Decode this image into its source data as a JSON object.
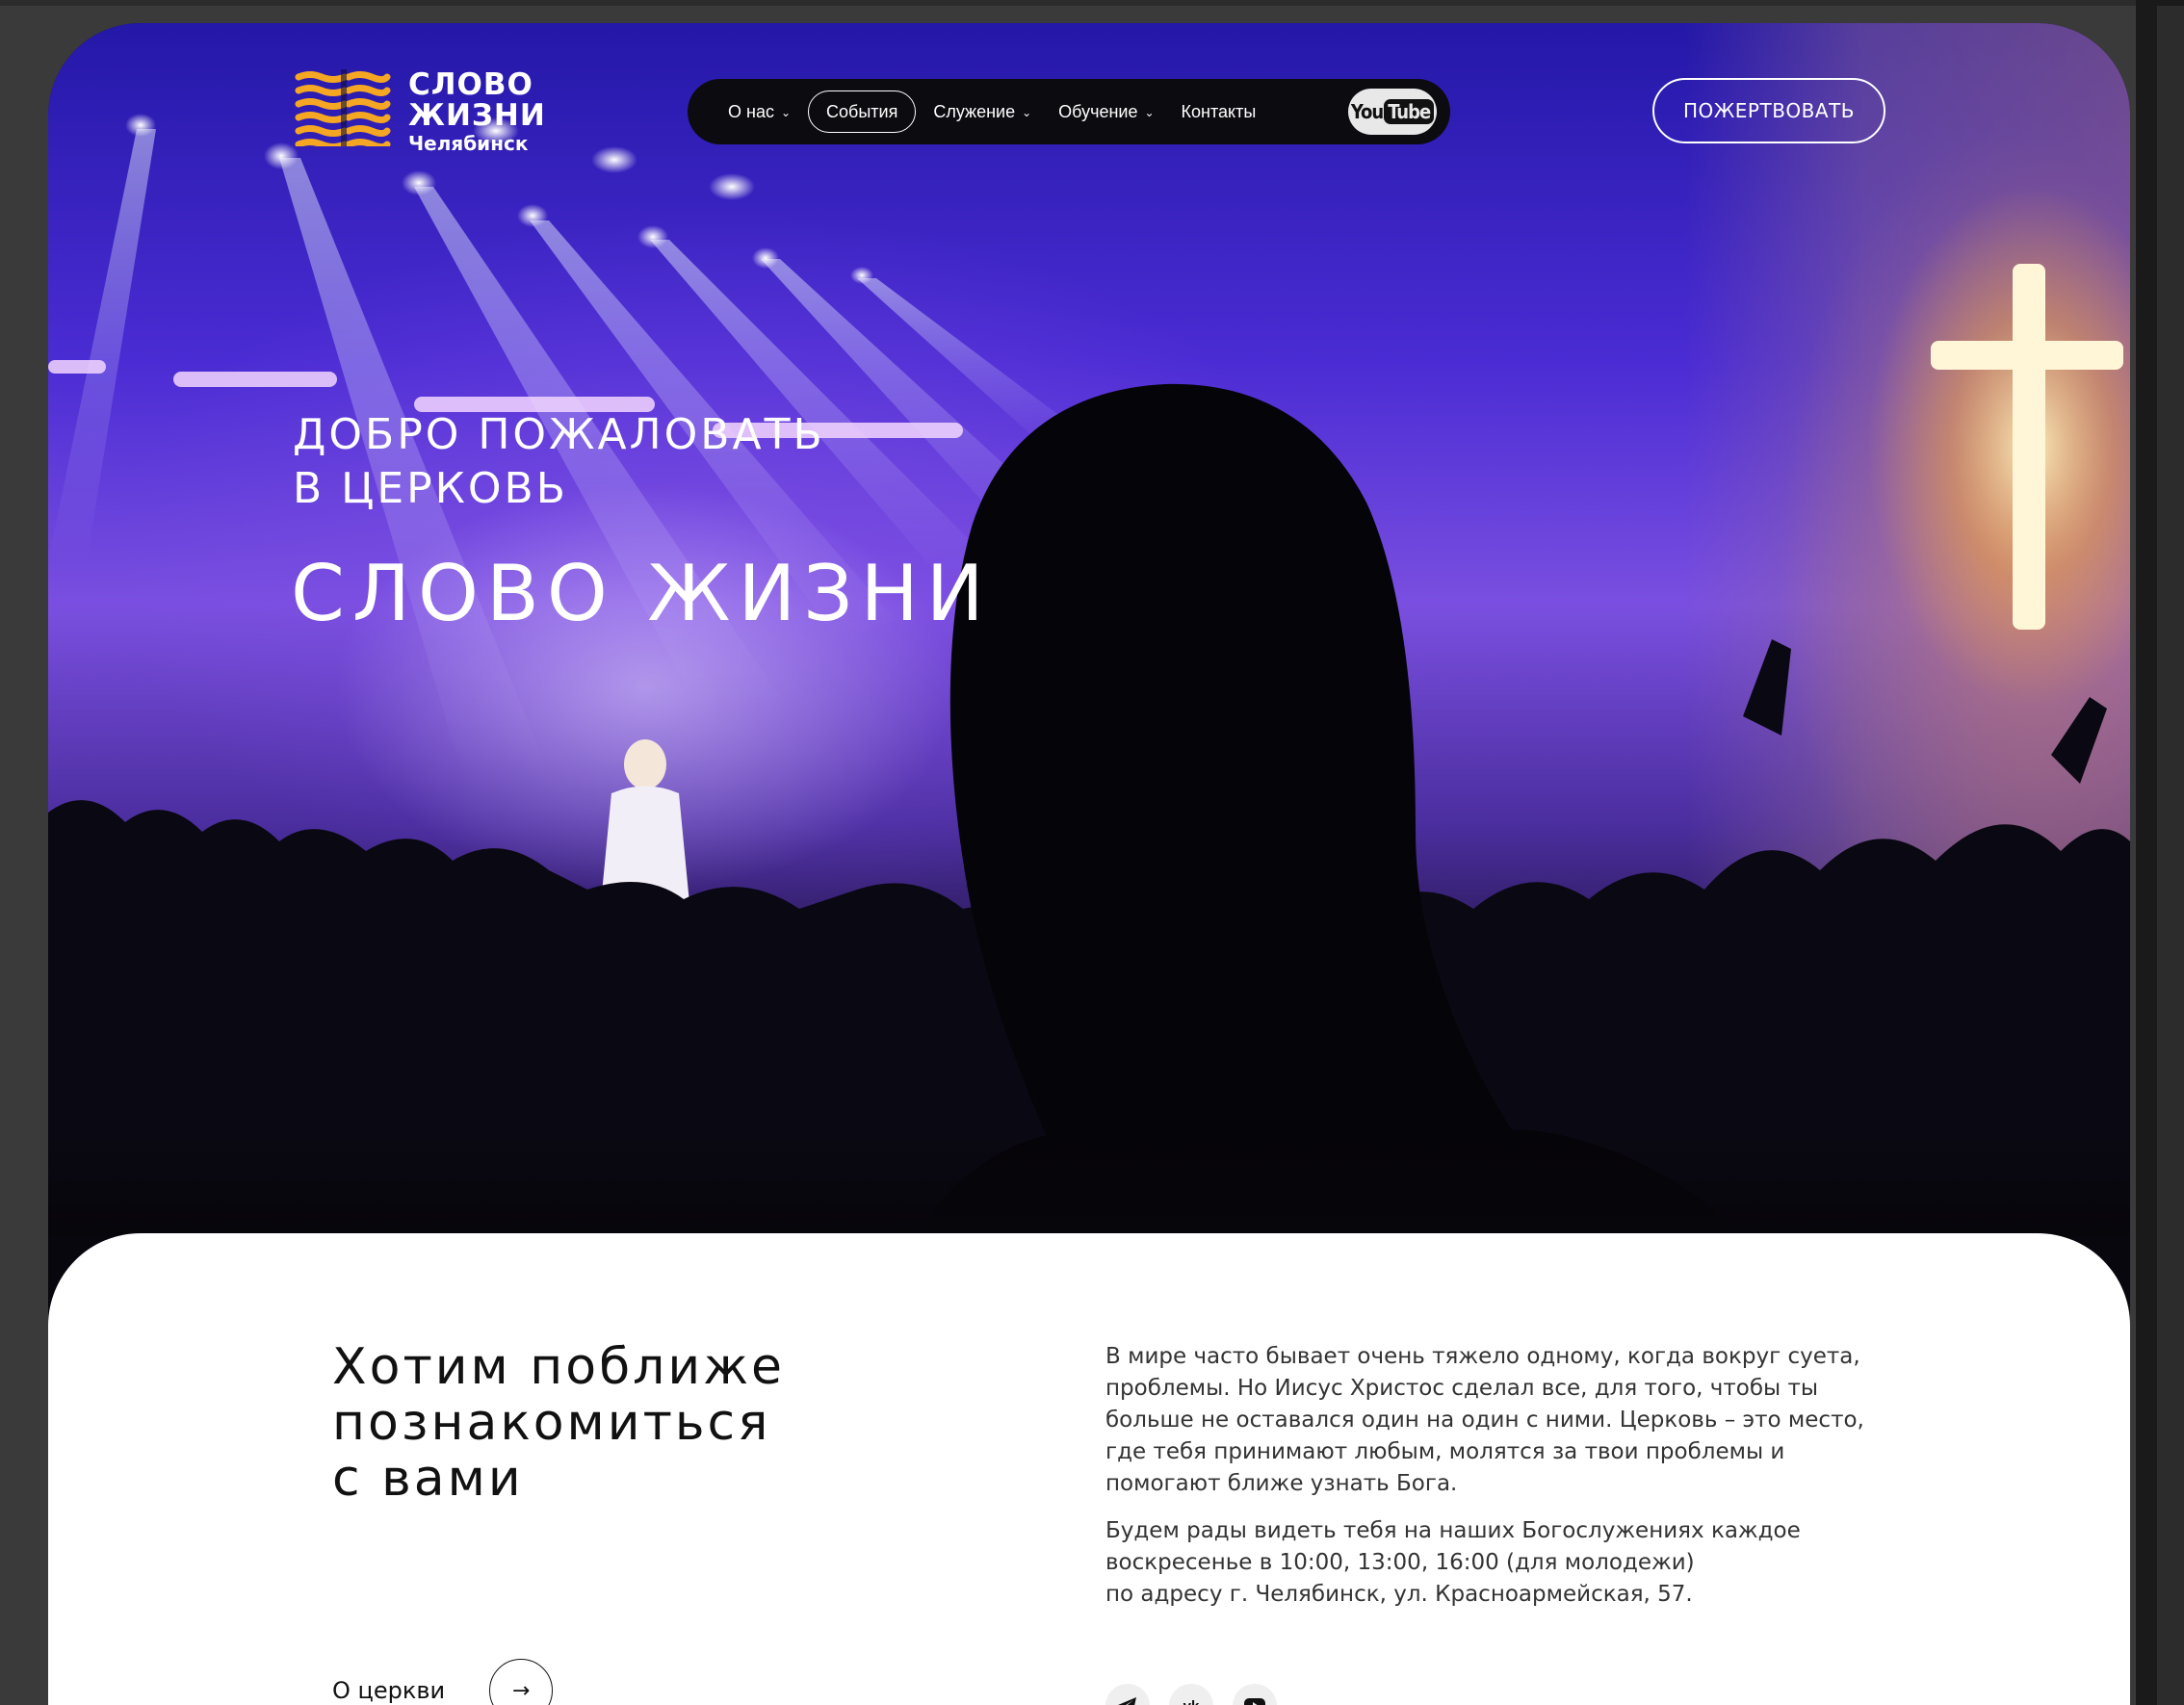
{
  "header": {
    "logo": {
      "line1": "СЛОВО",
      "line2": "ЖИЗНИ",
      "city": "Челябинск"
    },
    "nav": [
      {
        "label": "О нас",
        "dropdown": true
      },
      {
        "label": "События",
        "dropdown": false,
        "active": true
      },
      {
        "label": "Служение",
        "dropdown": true
      },
      {
        "label": "Обучение",
        "dropdown": true
      },
      {
        "label": "Контакты",
        "dropdown": false
      }
    ],
    "youtube": {
      "you": "You",
      "tube": "Tube"
    },
    "donate_label": "ПОЖЕРТВОВАТЬ"
  },
  "hero": {
    "subtitle_line1": "ДОБРО ПОЖАЛОВАТЬ",
    "subtitle_line2": "В ЦЕРКОВЬ",
    "title": "СЛОВО ЖИЗНИ"
  },
  "about": {
    "heading_line1": "Хотим поближе",
    "heading_line2": "познакомиться",
    "heading_line3": "с вами",
    "paragraph1": "В мире часто бывает очень тяжело одному, когда вокруг суета, проблемы. Но Иисус Христос сделал все, для того, чтобы ты больше не оставался один на один с ними. Церковь – это место, где тебя принимают любым, молятся за твои проблемы и помогают ближе узнать Бога.",
    "paragraph2_line1": "Будем рады видеть тебя на наших Богослужениях каждое воскресенье в 10:00, 13:00, 16:00 (для молодежи)",
    "paragraph2_line2": "по адресу г. Челябинск, ул. Красноармейская, 57.",
    "link_label": "О церкви",
    "socials": [
      "telegram-icon",
      "vk-icon",
      "youtube-icon"
    ]
  },
  "colors": {
    "logo_accent": "#F5A623",
    "hero_purple": "#4b2cd4",
    "nav_bg": "#0c0b10"
  }
}
